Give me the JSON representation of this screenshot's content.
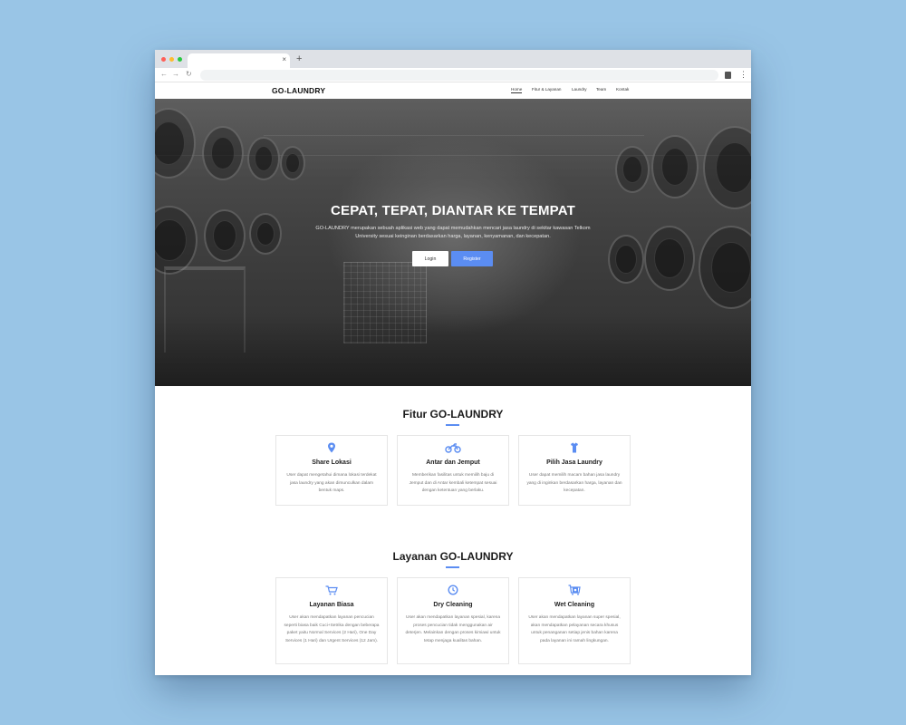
{
  "browser": {
    "tab_close": "×",
    "new_tab": "+",
    "nav_back": "←",
    "nav_forward": "→",
    "nav_reload": "↻",
    "menu": "⋮"
  },
  "site": {
    "brand": "GO-LAUNDRY",
    "nav": [
      "Home",
      "Fitur & Layanan",
      "Laundry",
      "Team",
      "Kontak"
    ],
    "nav_active": "Home"
  },
  "hero": {
    "title": "CEPAT, TEPAT, DIANTAR KE TEMPAT",
    "description": "GO-LAUNDRY merupakan sebuah aplikasi web yang dapat memudahkan mencari jasa laundry di sekitar kawasan Telkom University sesuai keinginan berdasarkan harga, layanan, kenyamanan, dan kecepatan.",
    "login_label": "Login",
    "register_label": "Register"
  },
  "features": {
    "title": "Fitur GO-LAUNDRY",
    "cards": [
      {
        "icon": "map-pin-icon",
        "title": "Share Lokasi",
        "desc": "User dapat mengetahui dimana lokasi terdekat jasa laundry yang akan dimunculkan dalam bentuk maps."
      },
      {
        "icon": "motorcycle-icon",
        "title": "Antar dan Jemput",
        "desc": "Memberikan fasilitas untuk memilih baju di Jemput dan di Antar kembali ketempat sesuai dengan ketentuan yang berlaku."
      },
      {
        "icon": "shirt-icon",
        "title": "Pilih Jasa Laundry",
        "desc": "User dapat memilih macam bahan jasa laundry yang di inginkan berdasarkan harga, layanan dan kecepatan."
      }
    ]
  },
  "services": {
    "title": "Layanan GO-LAUNDRY",
    "cards": [
      {
        "icon": "cart-icon",
        "title": "Layanan Biasa",
        "desc": "User akan mendapatkan layanan pencucian seperti biasa baik Cuci+Setrika dengan beberapa paket yaitu Normal Services (2 Hari), One Day Services (1 Hari) dan Urgent Services (12 Jam)."
      },
      {
        "icon": "clock-icon",
        "title": "Dry Cleaning",
        "desc": "User akan mendapatkan layanan spesial, karena proses pencucian tidak menggunakan air deterjen. Melainkan dengan proses kimiawi untuk tetap menjaga kualitas bahan."
      },
      {
        "icon": "washing-machine-icon",
        "title": "Wet Cleaning",
        "desc": "User akan mendapatkan layanan super spesial, akan mendapatkan pelayanan secara khusus untuk penanganan setiap jenis bahan karena pada layanan ini ramah lingkungan."
      }
    ]
  },
  "colors": {
    "accent": "#5b8df2",
    "page_background": "#99c5e6"
  }
}
